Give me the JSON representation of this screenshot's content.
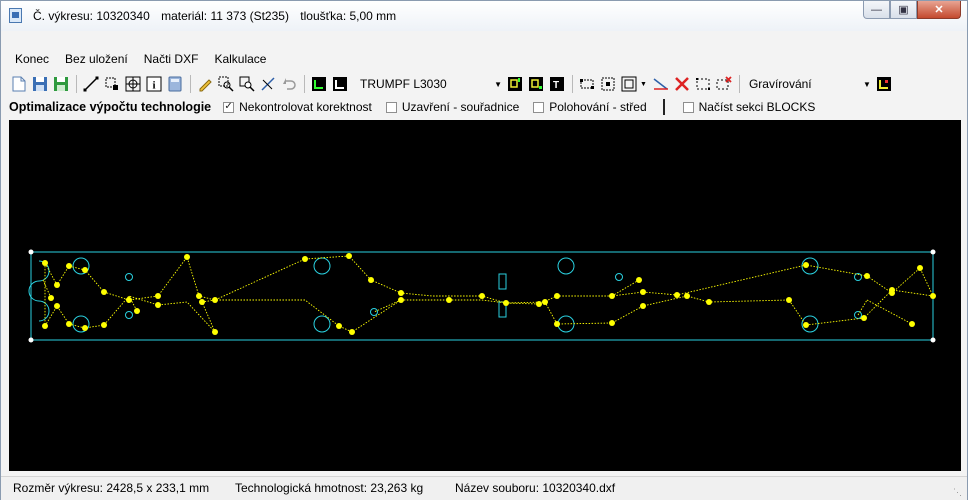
{
  "window": {
    "title_parts": [
      "Č. výkresu: 10320340",
      "materiál: 11 373 (St235)",
      "tloušťka: 5,00 mm"
    ]
  },
  "menu": [
    "Konec",
    "Bez uložení",
    "Načti DXF",
    "Kalkulace"
  ],
  "toolbar": {
    "machine": "TRUMPF L3030",
    "process": "Gravírování"
  },
  "options": {
    "heading": "Optimalizace výpočtu technologie",
    "checks": [
      {
        "label": "Nekontrolovat korektnost",
        "checked": true
      },
      {
        "label": "Uzavření - souřadnice",
        "checked": false
      },
      {
        "label": "Polohování - střed",
        "checked": false
      },
      {
        "label": "Načíst sekci BLOCKS",
        "checked": false
      }
    ]
  },
  "colors": {
    "outline": "#2ad1e0",
    "path": "#ffff00",
    "background": "#000000"
  },
  "status": {
    "size": "Rozměr výkresu: 2428,5 x 233,1 mm",
    "weight": "Technologická hmotnost: 23,263 kg",
    "file": "Název souboru: 10320340.dxf"
  }
}
